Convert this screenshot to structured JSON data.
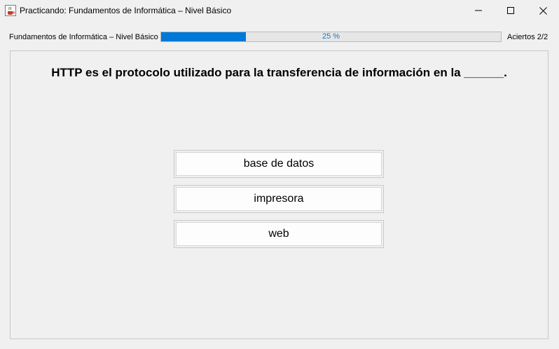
{
  "window": {
    "title": "Practicando: Fundamentos de Informática – Nivel Básico",
    "icon": "java-cup-icon",
    "controls": [
      "minimize-icon",
      "maximize-icon",
      "close-icon"
    ]
  },
  "status": {
    "course_label": "Fundamentos de Informática – Nivel Básico",
    "progress": {
      "value": 25,
      "text": "25 %"
    },
    "score_label": "Aciertos 2/2"
  },
  "quiz": {
    "question": "HTTP es el protocolo utilizado para la transferencia de información en la ______.",
    "options": [
      {
        "label": "base de datos"
      },
      {
        "label": "impresora"
      },
      {
        "label": "web"
      }
    ]
  },
  "colors": {
    "accent": "#0078d7",
    "progress_text": "#1979ca",
    "background": "#f0f0f0"
  }
}
